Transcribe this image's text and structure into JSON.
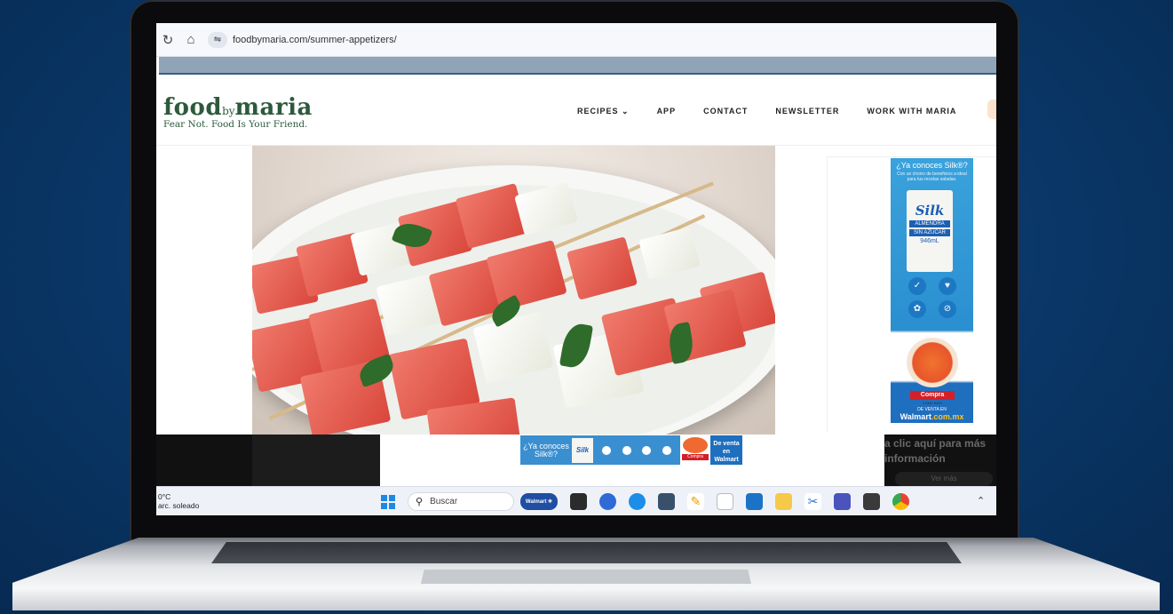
{
  "browser": {
    "url": "foodbymaria.com/summer-appetizers/"
  },
  "site": {
    "logo_main_1": "food",
    "logo_small": "by",
    "logo_main_2": "maria",
    "tagline": "Fear Not. Food Is Your Friend.",
    "menu": [
      "RECIPES ⌄",
      "APP",
      "CONTACT",
      "NEWSLETTER",
      "WORK WITH MARIA"
    ]
  },
  "side_ad": {
    "title": "¿Ya conoces Silk®?",
    "subtitle": "Con un chorro de beneficios a ideal para tus recetas saladas.",
    "brand": "Silk",
    "line1": "ALMENDRA",
    "line2": "SIN AZÚCAR",
    "volume": "946mL",
    "cta": "Compra",
    "cta_sub": "COME BIEN",
    "retailer_line": "DE VENTA EN",
    "retailer_name": "Walmart",
    "retailer_domain": ".com.mx"
  },
  "bottom_ad": {
    "title": "¿Ya conoces Silk®?",
    "brand": "Silk",
    "cta": "Compra",
    "retailer": "De venta en Walmart .com.mx",
    "close": "✕"
  },
  "overlay": {
    "text": "a clic aquí para más información",
    "button": "Ver más"
  },
  "taskbar": {
    "temp": "0°C",
    "weather": "arc. soleado",
    "search_label": "Buscar",
    "walmart_label": "Walmart ✳"
  }
}
